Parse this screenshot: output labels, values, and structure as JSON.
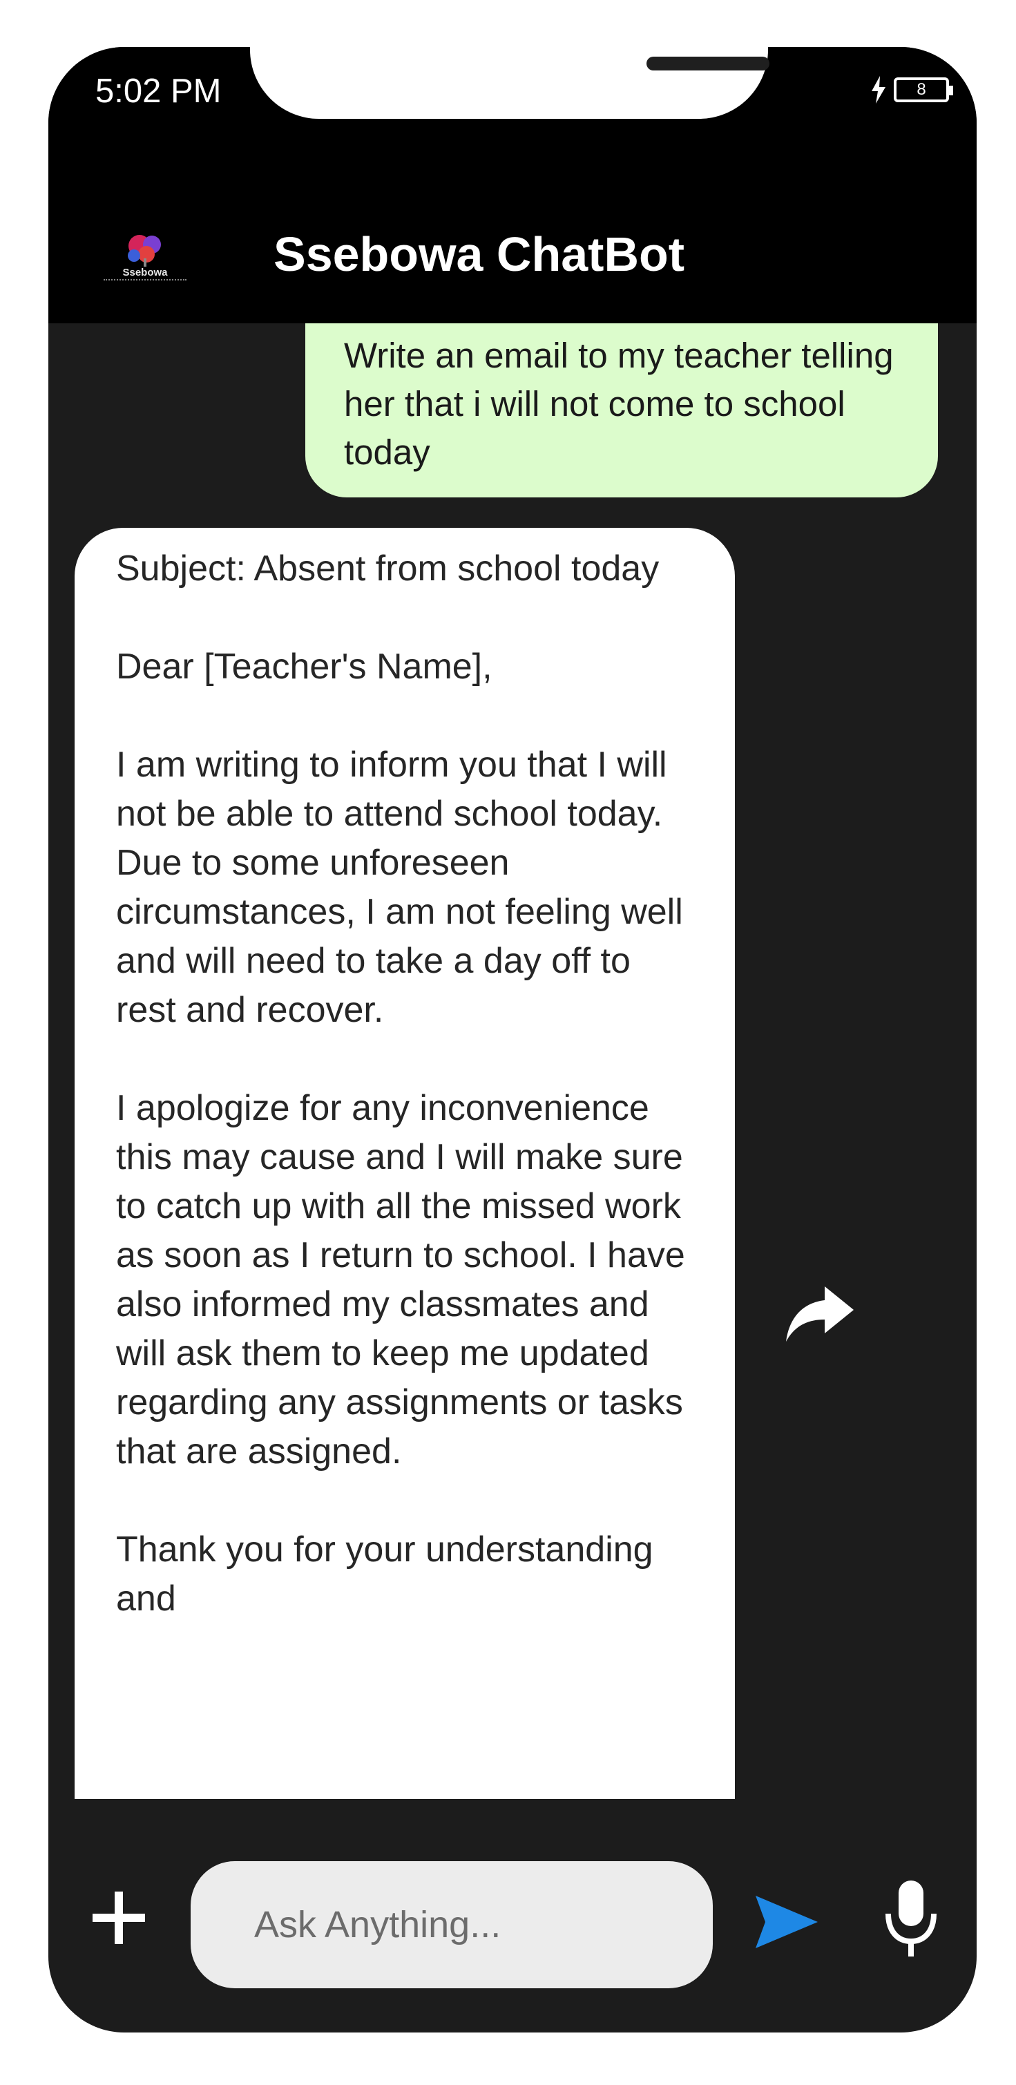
{
  "status_bar": {
    "time": "5:02 PM",
    "battery_level": "8"
  },
  "app_bar": {
    "logo_text": "Ssebowa",
    "title": "Ssebowa ChatBot"
  },
  "messages": {
    "user": "Write an email to my teacher telling her that i will not come to school today",
    "bot_paragraphs": [
      "Subject: Absent from school today",
      "Dear [Teacher's Name],",
      "I am writing to inform you that I will not be able to attend school today. Due to some unforeseen circumstances, I am not feeling well and will need to take a day off to rest and recover.",
      "I apologize for any inconvenience this may cause and I will make sure to catch up with all the missed work as soon as I return to school. I have also informed my classmates and will ask them to keep me updated regarding any assignments or tasks that are assigned.",
      "Thank you for your understanding and"
    ]
  },
  "composer": {
    "placeholder": "Ask Anything..."
  },
  "colors": {
    "background": "#1c1c1c",
    "app_bar": "#000000",
    "user_bubble": "#dcfccc",
    "bot_bubble": "#ffffff",
    "send_accent": "#1e88e5"
  },
  "icons": {
    "share": "share-forward-icon",
    "add": "plus-icon",
    "send": "send-icon",
    "mic": "microphone-icon",
    "charging": "charging-bolt-icon"
  }
}
